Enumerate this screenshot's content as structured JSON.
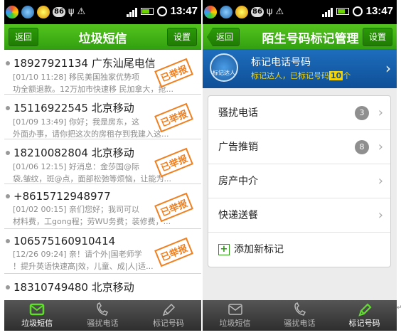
{
  "status": {
    "time": "13:47",
    "badge": "86"
  },
  "left": {
    "back_label": "返回",
    "title": "垃圾短信",
    "settings_label": "设置",
    "messages": [
      {
        "number": "18927921134 广东汕尾电信",
        "preview1": "[01/10 11:28] 移民美国独家优势项",
        "preview2": "功全额退款。12万加市快速移 民加拿大，抢...",
        "stamp": "已举报"
      },
      {
        "number": "15116922545 北京移动",
        "preview1": "[01/09 13:49] 你好；我是房东，这",
        "preview2": "外面办事，请你把这次的房租存到我建入这...",
        "stamp": "已举报"
      },
      {
        "number": "18210082804 北京移动",
        "preview1": "[01/06 12:15] 好消息：金莎国@际",
        "preview2": "袋,皱纹，斑@点，面部松弛等烦恼，让能为...",
        "stamp": "已举报"
      },
      {
        "number": "+8615712948977",
        "preview1": "[01/02 00:15] 亲们您好；我司可以",
        "preview2": "材料费，工gong程；劳WU务费；装修费，...",
        "stamp": "已举报"
      },
      {
        "number": "106575160910414",
        "preview1": "[12/26 09:24] 亲！请个外|国老师学",
        "preview2": "！提升英语快速高|效，儿童、成|人|适...",
        "stamp": "已举报"
      },
      {
        "number": "18310749480 北京移动",
        "preview1": "",
        "preview2": "",
        "stamp": ""
      }
    ],
    "tabs": [
      "垃圾短信",
      "骚扰电话",
      "标记号码"
    ]
  },
  "right": {
    "back_label": "返回",
    "title": "陌生号码标记管理",
    "settings_label": "设置",
    "banner": {
      "icon_text": "标记达人",
      "title": "标记电话号码",
      "sub_prefix": "标记达人，已标记号码",
      "count": "10",
      "sub_suffix": "个"
    },
    "items": [
      {
        "label": "骚扰电话",
        "count": "3"
      },
      {
        "label": "广告推销",
        "count": "8"
      },
      {
        "label": "房产中介",
        "count": ""
      },
      {
        "label": "快递送餐",
        "count": ""
      }
    ],
    "add_label": "添加新标记",
    "tabs": [
      "垃圾短信",
      "骚扰电话",
      "标记号码"
    ]
  },
  "colors": {
    "brand_green": "#3fb018",
    "stamp": "#f08020",
    "banner_blue": "#1d6dbd"
  }
}
